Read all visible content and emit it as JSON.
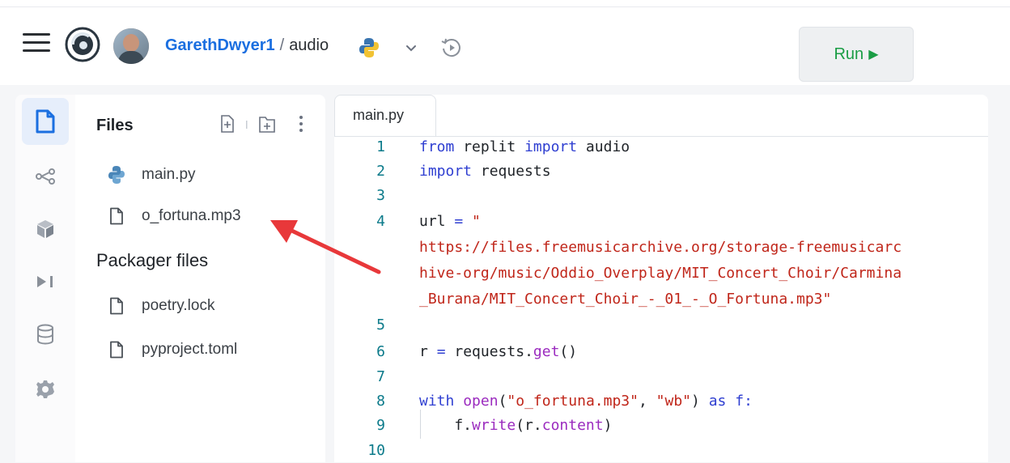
{
  "header": {
    "owner": "GarethDwyer1",
    "separator": "/",
    "repl_name": "audio",
    "run_label": "Run",
    "run_icon": "▶"
  },
  "rail": {
    "items": [
      "files-icon",
      "share-icon",
      "packages-icon",
      "console-icon",
      "database-icon",
      "settings-icon"
    ]
  },
  "files_panel": {
    "title": "Files",
    "files": [
      {
        "name": "main.py",
        "icon": "python-icon"
      },
      {
        "name": "o_fortuna.mp3",
        "icon": "file-icon"
      }
    ],
    "packager_title": "Packager files",
    "packager_files": [
      {
        "name": "poetry.lock",
        "icon": "file-icon"
      },
      {
        "name": "pyproject.toml",
        "icon": "file-icon"
      }
    ]
  },
  "editor": {
    "tab_label": "main.py",
    "line_numbers": [
      "1",
      "2",
      "3",
      "4",
      "5",
      "6",
      "7",
      "8",
      "9",
      "10"
    ],
    "lines": {
      "l1": {
        "kw_from": "from",
        "mod": " replit ",
        "kw_import": "import",
        "rest": " audio"
      },
      "l2": {
        "kw_import": "import",
        "rest": " requests"
      },
      "l4": {
        "var": "url ",
        "op": "=",
        "str": " \""
      },
      "l4b": "https://files.freemusicarchive.org/storage-freemusicarc",
      "l4c": "hive-org/music/Oddio_Overplay/MIT_Concert_Choir/Carmina",
      "l4d": "_Burana/MIT_Concert_Choir_-_01_-_O_Fortuna.mp3\"",
      "l6": {
        "a": "r ",
        "op": "=",
        "b": " requests.",
        "fn": "get",
        "c": "()"
      },
      "l8": {
        "kw_with": "with",
        "sp": " ",
        "fn": "open",
        "p1": "(",
        "s1": "\"o_fortuna.mp3\"",
        "comma": ", ",
        "s2": "\"wb\"",
        "p2": ") ",
        "kw_as": "as",
        "f": " f",
        "colon": ":"
      },
      "l9": {
        "indent": "    f.",
        "fn": "write",
        "p1": "(r.",
        "attr": "content",
        "p2": ")"
      }
    }
  },
  "colors": {
    "accent": "#1b6fe0",
    "run_green": "#1a9d45",
    "keyword": "#2f3fd1",
    "string": "#c0261a",
    "function": "#9b2bbf",
    "arrow_red": "#e8383a"
  }
}
